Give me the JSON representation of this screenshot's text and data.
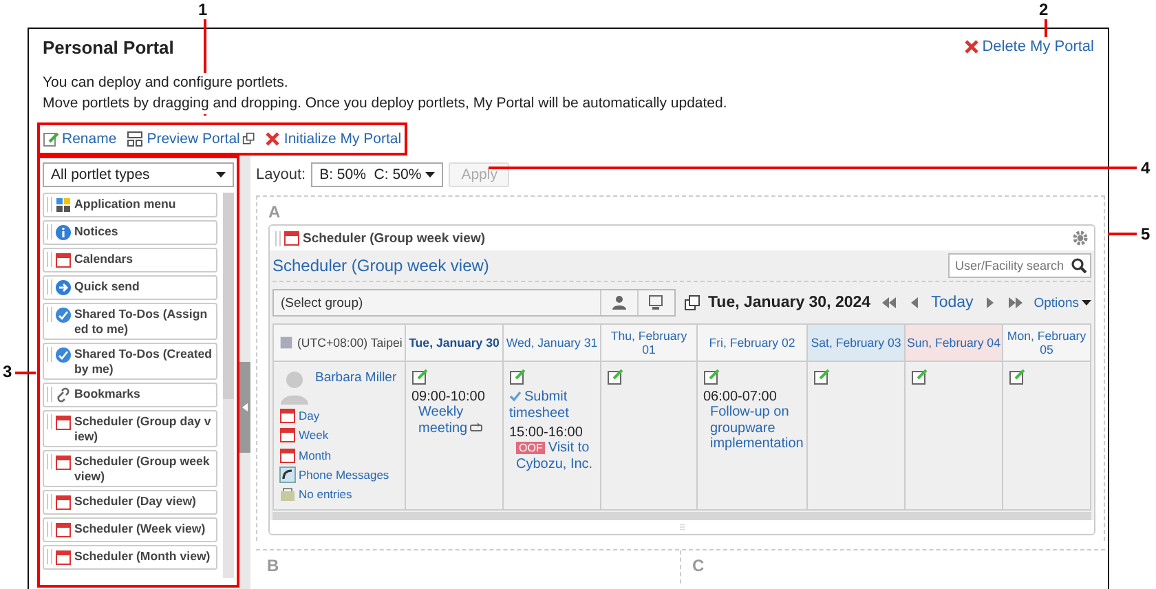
{
  "callouts": [
    {
      "label": "1"
    },
    {
      "label": "2"
    },
    {
      "label": "3"
    },
    {
      "label": "4"
    },
    {
      "label": "5"
    }
  ],
  "page": {
    "title": "Personal Portal",
    "delete_link": "Delete My Portal",
    "description": [
      "You can deploy and configure portlets.",
      "Move portlets by dragging and dropping. Once you deploy portlets, My Portal will be automatically updated."
    ]
  },
  "toolbar": [
    {
      "kind": "rename",
      "label": "Rename"
    },
    {
      "kind": "preview",
      "label": "Preview Portal"
    },
    {
      "kind": "initialize",
      "label": "Initialize My Portal"
    }
  ],
  "palette": {
    "filter": "All portlet types",
    "items": [
      {
        "kind": "apps",
        "label": "Application menu"
      },
      {
        "kind": "info",
        "label": "Notices"
      },
      {
        "kind": "calendar",
        "label": "Calendars"
      },
      {
        "kind": "send",
        "label": "Quick send"
      },
      {
        "kind": "todo",
        "label": "Shared To-Dos (Assigned to me)"
      },
      {
        "kind": "todo",
        "label": "Shared To-Dos (Created by me)"
      },
      {
        "kind": "link",
        "label": "Bookmarks"
      },
      {
        "kind": "calendar",
        "label": "Scheduler (Group day view)"
      },
      {
        "kind": "calendar",
        "label": "Scheduler (Group week view)"
      },
      {
        "kind": "calendar",
        "label": "Scheduler (Day view)"
      },
      {
        "kind": "calendar",
        "label": "Scheduler (Week view)"
      },
      {
        "kind": "calendar",
        "label": "Scheduler (Month view)"
      }
    ]
  },
  "layout": {
    "label": "Layout:",
    "value": "B: 50%  C: 50%",
    "apply": "Apply",
    "apply_disabled": true
  },
  "zones": [
    {
      "label": "A"
    },
    {
      "label": "B"
    },
    {
      "label": "C"
    }
  ],
  "portlet": {
    "header": "Scheduler (Group week view)",
    "title_link": "Scheduler (Group week view)",
    "search_placeholder": "User/Facility search",
    "group_select": "(Select group)",
    "date": "Tue, January 30, 2024",
    "today": "Today",
    "options": "Options",
    "timezone": "(UTC+08:00) Taipei",
    "days": [
      {
        "kind": "today",
        "label": "Tue, January 30"
      },
      {
        "kind": "weekday",
        "label": "Wed, January 31"
      },
      {
        "kind": "weekday",
        "label": "Thu, February 01"
      },
      {
        "kind": "weekday",
        "label": "Fri, February 02"
      },
      {
        "kind": "saturday",
        "label": "Sat, February 03"
      },
      {
        "kind": "sunday",
        "label": "Sun, February 04"
      },
      {
        "kind": "weekday",
        "label": "Mon, February 05"
      }
    ],
    "user": {
      "name": "Barbara Miller",
      "links": [
        {
          "kind": "day",
          "label": "Day"
        },
        {
          "kind": "week",
          "label": "Week"
        },
        {
          "kind": "month",
          "label": "Month"
        },
        {
          "kind": "phone",
          "label": "Phone Messages"
        },
        {
          "kind": "entries",
          "label": "No entries"
        }
      ]
    },
    "cells": [
      {
        "events": [
          {
            "kind": "appointment",
            "time": "09:00-10:00",
            "title": "Weekly meeting",
            "repeat": true
          }
        ]
      },
      {
        "events": [
          {
            "kind": "todo",
            "title": "Submit timesheet"
          },
          {
            "kind": "appointment",
            "time": "15:00-16:00",
            "badge": "OOF",
            "title": "Visit to Cybozu, Inc."
          }
        ]
      },
      {},
      {
        "events": [
          {
            "kind": "appointment",
            "time": "06:00-07:00",
            "title": "Follow-up on groupware implementation"
          }
        ]
      },
      {},
      {},
      {}
    ]
  }
}
